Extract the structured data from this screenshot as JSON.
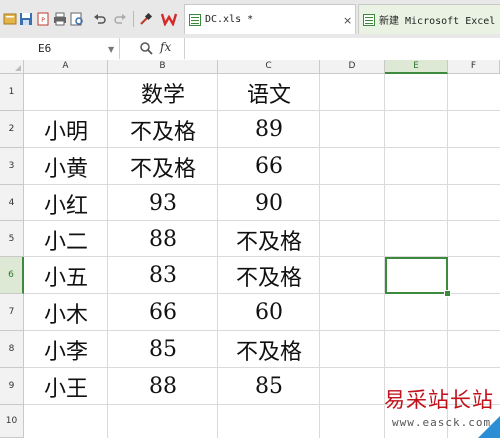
{
  "toolbar": {
    "icons": [
      "quick-open-icon",
      "save-icon",
      "export-pdf-icon",
      "print-icon",
      "print-preview-icon",
      "undo-icon",
      "redo-icon",
      "format-painter-icon",
      "wps-logo-icon"
    ]
  },
  "tabs": [
    {
      "label": "DC.xls *",
      "active": true,
      "close": "×"
    },
    {
      "label": "新建 Microsoft Excel 工",
      "active": false
    }
  ],
  "formula_bar": {
    "name_box": "E6",
    "fx_label": "fx",
    "formula": ""
  },
  "sheet": {
    "columns": [
      "A",
      "B",
      "C",
      "D",
      "E",
      "F"
    ],
    "rows": [
      "1",
      "2",
      "3",
      "4",
      "5",
      "6",
      "7",
      "8",
      "9",
      "10"
    ],
    "selected_column": "E",
    "selected_row": "6",
    "header_row": {
      "b": "数学",
      "c": "语文"
    },
    "data": [
      {
        "name": "小明",
        "math": "不及格",
        "chinese": "89"
      },
      {
        "name": "小黄",
        "math": "不及格",
        "chinese": "66"
      },
      {
        "name": "小红",
        "math": "93",
        "chinese": "90"
      },
      {
        "name": "小二",
        "math": "88",
        "chinese": "不及格"
      },
      {
        "name": "小五",
        "math": "83",
        "chinese": "不及格"
      },
      {
        "name": "小木",
        "math": "66",
        "chinese": "60"
      },
      {
        "name": "小李",
        "math": "85",
        "chinese": "不及格"
      },
      {
        "name": "小王",
        "math": "88",
        "chinese": "85"
      }
    ]
  },
  "watermark": {
    "title": "易采站长站",
    "url": "www.easck.com"
  },
  "colors": {
    "accent": "#3c8a3c",
    "watermark": "#c0121b"
  }
}
